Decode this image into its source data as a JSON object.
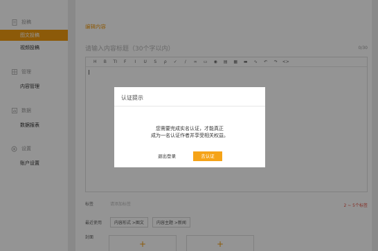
{
  "sidebar": {
    "sections": [
      {
        "label": "投稿",
        "icon": "document-icon",
        "items": [
          "图文投稿",
          "视频投稿"
        ]
      },
      {
        "label": "管理",
        "icon": "grid-icon",
        "items": [
          "内容管理"
        ]
      },
      {
        "label": "数据",
        "icon": "chart-icon",
        "items": [
          "数据报表"
        ]
      },
      {
        "label": "设置",
        "icon": "gear-icon",
        "items": [
          "账户设置"
        ]
      }
    ],
    "active_item": "图文投稿"
  },
  "main": {
    "page_title": "编辑内容",
    "title_placeholder": "请输入内容标题（30个字以内）",
    "title_counter": "0/30",
    "toolbar_icons": [
      "H",
      "B",
      "TI",
      "F",
      "I",
      "U",
      "S",
      "ρ",
      "✓",
      "∕",
      "∞",
      "▭",
      "◉",
      "▤",
      "▦",
      "▬",
      "∿",
      "↶",
      "↷",
      "<>"
    ],
    "tags_label": "标签",
    "tags_hint": "请添加标签",
    "tags_requirement": "2 ~ 5个标签",
    "recent_label": "最近使用",
    "recent_chips": [
      "内容形式 >图文",
      "内容主题 >新闻"
    ],
    "cover_label": "封面",
    "cover_add_symbol": "+"
  },
  "modal": {
    "title": "认证提示",
    "message_line1": "您需要完成实名认证，才能真正",
    "message_line2": "成为一名认证作者并享受相关权益。",
    "logout_label": "退出登录",
    "verify_label": "去认证"
  },
  "colors": {
    "accent": "#f29c11",
    "button": "#f5a318",
    "warning": "#e04b3c"
  }
}
